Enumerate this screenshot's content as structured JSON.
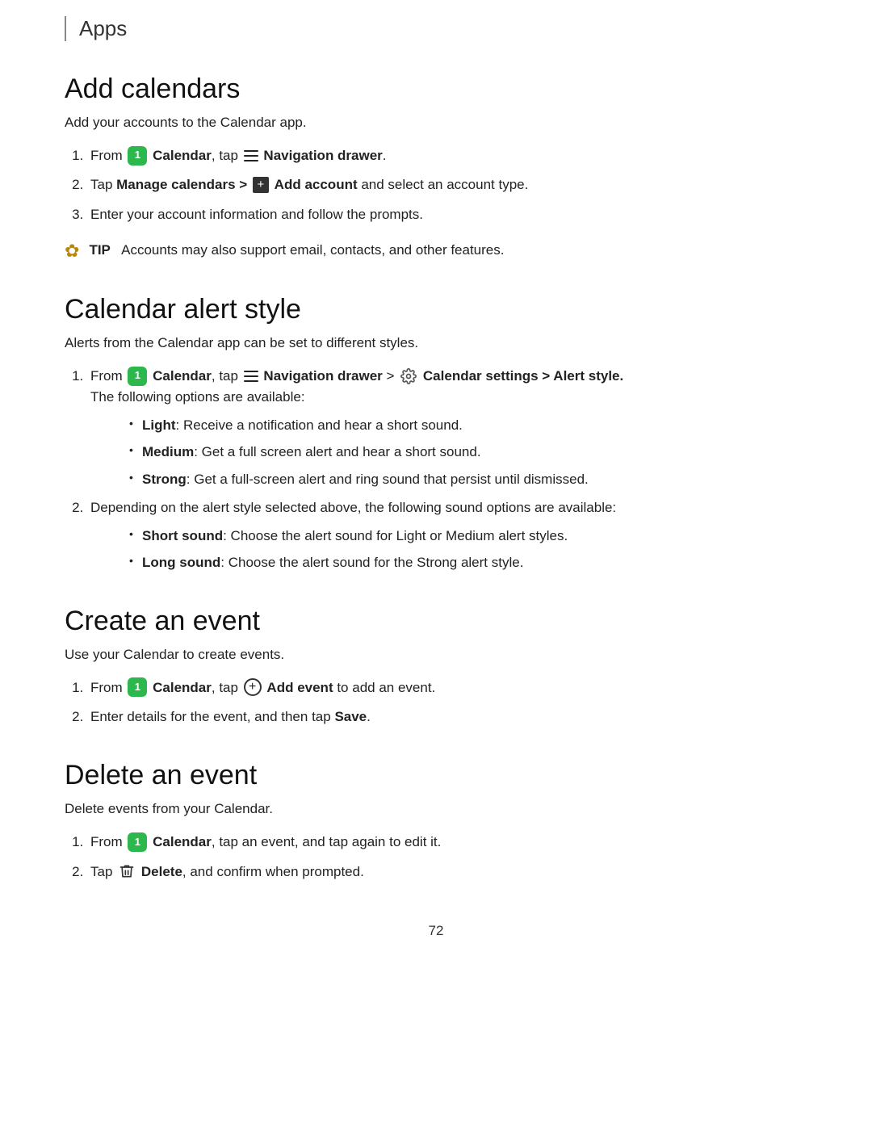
{
  "header": {
    "title": "Apps",
    "border": true
  },
  "sections": [
    {
      "id": "add-calendars",
      "heading": "Add calendars",
      "intro": "Add your accounts to the Calendar app.",
      "steps": [
        {
          "id": 1,
          "parts": [
            "from_calendar",
            "tap",
            "nav_drawer",
            "text1"
          ],
          "text_before": "From",
          "app_name": "Calendar",
          "tap_text": ", tap",
          "icon_type": "nav_drawer",
          "bold_text": "Navigation drawer",
          "text_after": "."
        },
        {
          "id": 2,
          "text": "Tap",
          "bold1": "Manage calendars >",
          "icon_type": "add_account",
          "bold2": "Add account",
          "text_after": "and select an account type."
        },
        {
          "id": 3,
          "text": "Enter your account information and follow the prompts."
        }
      ],
      "tip": {
        "show": true,
        "label": "TIP",
        "text": "Accounts may also support email, contacts, and other features."
      }
    },
    {
      "id": "calendar-alert-style",
      "heading": "Calendar alert style",
      "intro": "Alerts from the Calendar app can be set to different styles.",
      "steps": [
        {
          "id": 1,
          "text_before": "From",
          "has_calendar_icon": true,
          "app_name": "Calendar",
          "tap_text": ", tap",
          "has_nav_drawer": true,
          "bold_nav": "Navigation drawer >",
          "has_settings_icon": true,
          "bold_settings": "Calendar settings > Alert style.",
          "subtext": "The following options are available:",
          "bullets": [
            {
              "bold": "Light",
              "text": ": Receive a notification and hear a short sound."
            },
            {
              "bold": "Medium",
              "text": ": Get a full screen alert and hear a short sound."
            },
            {
              "bold": "Strong",
              "text": ": Get a full-screen alert and ring sound that persist until dismissed."
            }
          ]
        },
        {
          "id": 2,
          "text": "Depending on the alert style selected above, the following sound options are available:",
          "bullets": [
            {
              "bold": "Short sound",
              "text": ": Choose the alert sound for Light or Medium alert styles."
            },
            {
              "bold": "Long sound",
              "text": ": Choose the alert sound for the Strong alert style."
            }
          ]
        }
      ]
    },
    {
      "id": "create-event",
      "heading": "Create an event",
      "intro": "Use your Calendar to create events.",
      "steps": [
        {
          "id": 1,
          "text_before": "From",
          "has_calendar_icon": true,
          "app_name": "Calendar",
          "tap_text": ", tap",
          "has_add_icon": true,
          "bold_add": "Add event",
          "text_after": "to add an event."
        },
        {
          "id": 2,
          "text": "Enter details for the event, and then tap",
          "bold": "Save",
          "text_end": "."
        }
      ]
    },
    {
      "id": "delete-event",
      "heading": "Delete an event",
      "intro": "Delete events from your Calendar.",
      "steps": [
        {
          "id": 1,
          "text_before": "From",
          "has_calendar_icon": true,
          "app_name": "Calendar",
          "text": ", tap an event, and tap again to edit it."
        },
        {
          "id": 2,
          "text_before": "Tap",
          "has_trash_icon": true,
          "bold": "Delete",
          "text_after": ", and confirm when prompted."
        }
      ]
    }
  ],
  "page_number": "72"
}
